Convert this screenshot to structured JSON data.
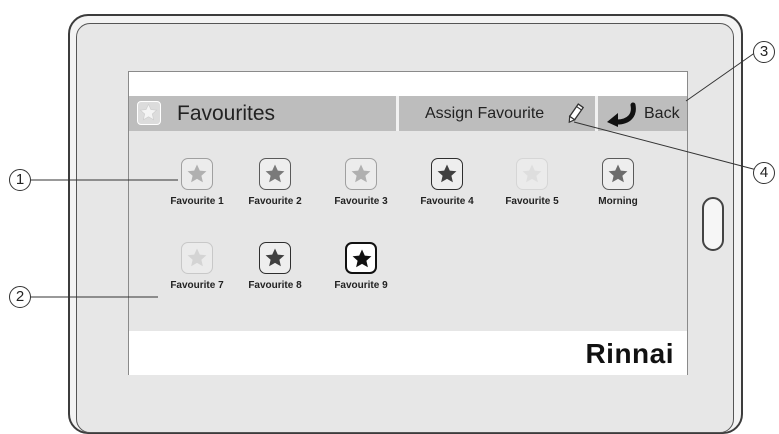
{
  "header": {
    "title": "Favourites",
    "assign_label": "Assign Favourite",
    "back_label": "Back"
  },
  "favourites": [
    {
      "label": "Favourite 1",
      "state": "inactive"
    },
    {
      "label": "Favourite 2",
      "state": "set"
    },
    {
      "label": "Favourite 3",
      "state": "inactive"
    },
    {
      "label": "Favourite 4",
      "state": "set-dark"
    },
    {
      "label": "Favourite 5",
      "state": "empty"
    },
    {
      "label": "Morning",
      "state": "set"
    },
    {
      "label": "Favourite 7",
      "state": "empty"
    },
    {
      "label": "Favourite 8",
      "state": "set-dark"
    },
    {
      "label": "Favourite 9",
      "state": "selected"
    }
  ],
  "brand": "Rinnai",
  "callouts": [
    "1",
    "2",
    "3",
    "4"
  ],
  "colors": {
    "header_bg": "#bdbdbd",
    "screen_bg": "#e6e6e6"
  }
}
